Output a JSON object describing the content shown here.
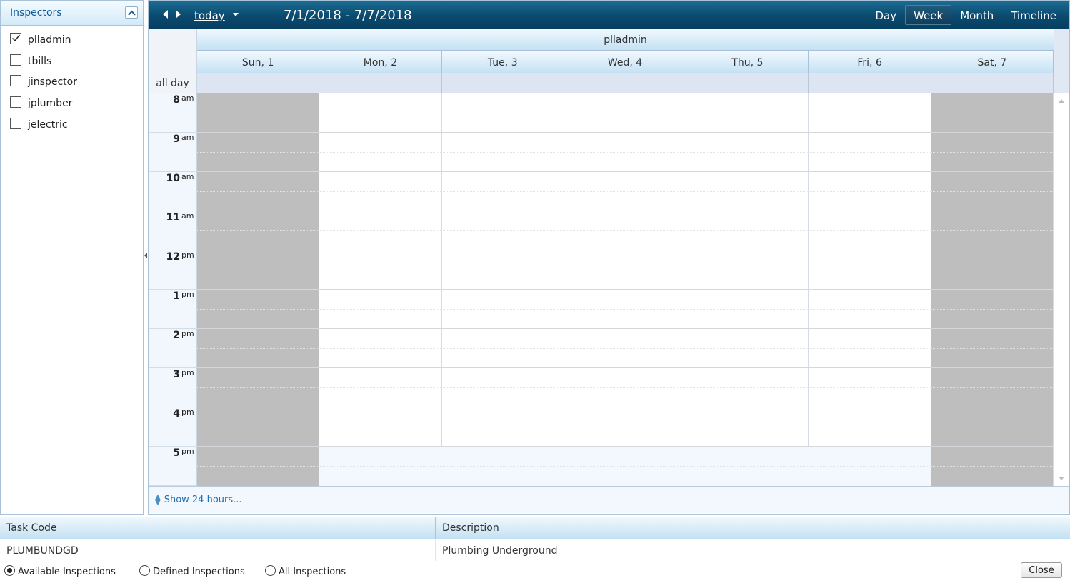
{
  "inspectors": {
    "title": "Inspectors",
    "items": [
      {
        "label": "plladmin",
        "checked": true
      },
      {
        "label": "tbills",
        "checked": false
      },
      {
        "label": "jinspector",
        "checked": false
      },
      {
        "label": "jplumber",
        "checked": false
      },
      {
        "label": "jelectric",
        "checked": false
      }
    ]
  },
  "scheduler": {
    "today_label": "today",
    "date_range": "7/1/2018 - 7/7/2018",
    "views": [
      {
        "label": "Day",
        "active": false
      },
      {
        "label": "Week",
        "active": true
      },
      {
        "label": "Month",
        "active": false
      },
      {
        "label": "Timeline",
        "active": false
      }
    ],
    "resource": "plladmin",
    "days": [
      {
        "label": "Sun, 1",
        "workday": false
      },
      {
        "label": "Mon, 2",
        "workday": true
      },
      {
        "label": "Tue, 3",
        "workday": true
      },
      {
        "label": "Wed, 4",
        "workday": true
      },
      {
        "label": "Thu, 5",
        "workday": true
      },
      {
        "label": "Fri, 6",
        "workday": true
      },
      {
        "label": "Sat, 7",
        "workday": false
      }
    ],
    "all_day_label": "all day",
    "hours": [
      {
        "hour": "8",
        "ampm": "am"
      },
      {
        "hour": "9",
        "ampm": "am"
      },
      {
        "hour": "10",
        "ampm": "am"
      },
      {
        "hour": "11",
        "ampm": "am"
      },
      {
        "hour": "12",
        "ampm": "pm"
      },
      {
        "hour": "1",
        "ampm": "pm"
      },
      {
        "hour": "2",
        "ampm": "pm"
      },
      {
        "hour": "3",
        "ampm": "pm"
      },
      {
        "hour": "4",
        "ampm": "pm"
      },
      {
        "hour": "5",
        "ampm": "pm"
      }
    ],
    "show_24_label": "Show 24 hours..."
  },
  "task_grid": {
    "columns": [
      "Task Code",
      "Description"
    ],
    "rows": [
      {
        "task_code": "PLUMBUNDGD",
        "description": "Plumbing Underground"
      }
    ]
  },
  "filter": {
    "options": [
      {
        "label": "Available Inspections",
        "checked": true
      },
      {
        "label": "Defined Inspections",
        "checked": false
      },
      {
        "label": "All Inspections",
        "checked": false
      }
    ]
  },
  "close_label": "Close",
  "colors": {
    "toolbar": "#0b4a6e",
    "non_working_day": "#bebebe",
    "header_gradient": "#c3e1f4",
    "all_day_cell": "#dde5f3",
    "link": "#1f6fb3"
  },
  "icons": [
    "collapse-up-icon",
    "check-icon",
    "prev-arrow-icon",
    "next-arrow-icon",
    "dropdown-caret-icon",
    "expand-icon"
  ]
}
